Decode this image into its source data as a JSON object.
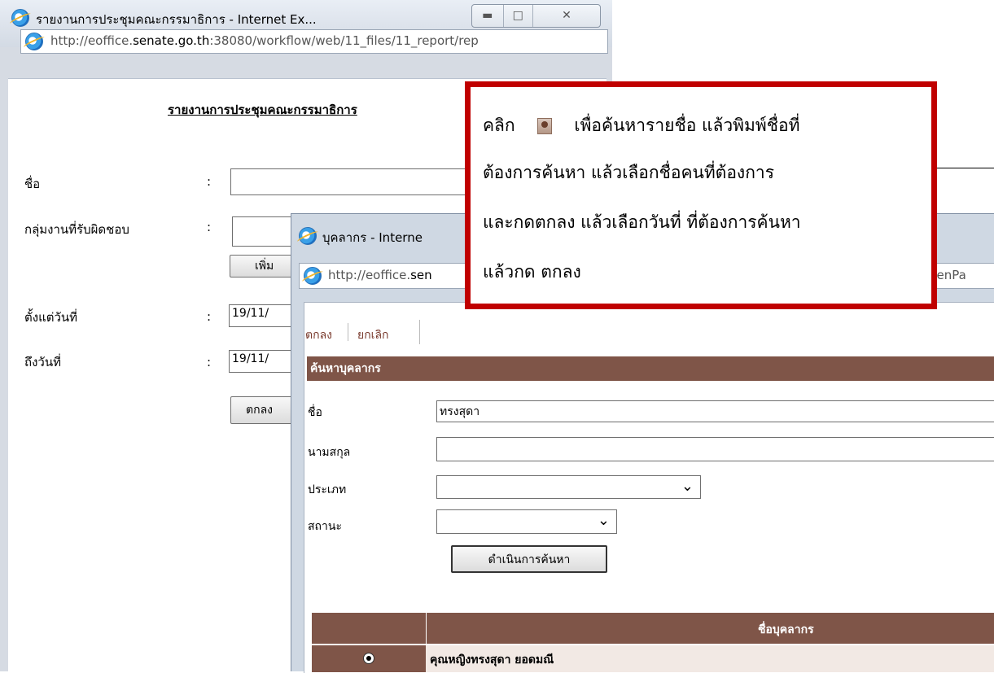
{
  "main_window": {
    "title": "รายงานการประชุมคณะกรรมาธิการ - Internet Ex...",
    "url_prefix": "http://eoffice.",
    "url_domain": "senate.go.th",
    "url_suffix": ":38080/workflow/web/11_files/11_report/rep",
    "report_title": "รายงานการประชุมคณะกรรมาธิการ",
    "fields": {
      "name_label": "ชื่อ",
      "group_label": "กลุ่มงานที่รับผิดชอบ",
      "from_label": "ตั้งแต่วันที่",
      "to_label": "ถึงวันที่",
      "colon": ":",
      "from_value": "19/11/",
      "to_value": "19/11/"
    },
    "add_button": "เพิ่ม",
    "ok_button": "ตกลง"
  },
  "popup_window": {
    "title": "บุคลากร - Interne",
    "url_prefix": "http://eoffice.",
    "url_domain": "sen",
    "url_tail": "penPa",
    "toolbar": {
      "ok": "ตกลง",
      "cancel": "ยกเลิก"
    },
    "section_title": "ค้นหาบุคลากร",
    "form": {
      "first_name_label": "ชื่อ",
      "first_name_value": "ทรงสุดา",
      "last_name_label": "นามสกุล",
      "last_name_value": "",
      "type_label": "ประเภท",
      "type_value": "",
      "status_label": "สถานะ",
      "status_value": ""
    },
    "search_button": "ดำเนินการค้นหา",
    "results": {
      "column_header": "ชื่อบุคลากร",
      "rows": [
        {
          "name": "คุณหญิงทรงสุดา ยอดมณี",
          "selected": true
        }
      ]
    }
  },
  "callout": {
    "line1_a": "คลิก",
    "line1_b": "เพื่อค้นหารายชื่อ  แล้วพิมพ์ชื่อที่",
    "line2": "ต้องการค้นหา        แล้วเลือกชื่อคนที่ต้องการ",
    "line3": "และกดตกลง แล้วเลือกวันที่ ที่ต้องการค้นหา",
    "line4": "แล้วกด ตกลง",
    "icon": "person-search-icon",
    "border_color": "#c00000"
  },
  "colors": {
    "header_brown": "#7f5548",
    "row_tint": "#f2e9e4"
  }
}
